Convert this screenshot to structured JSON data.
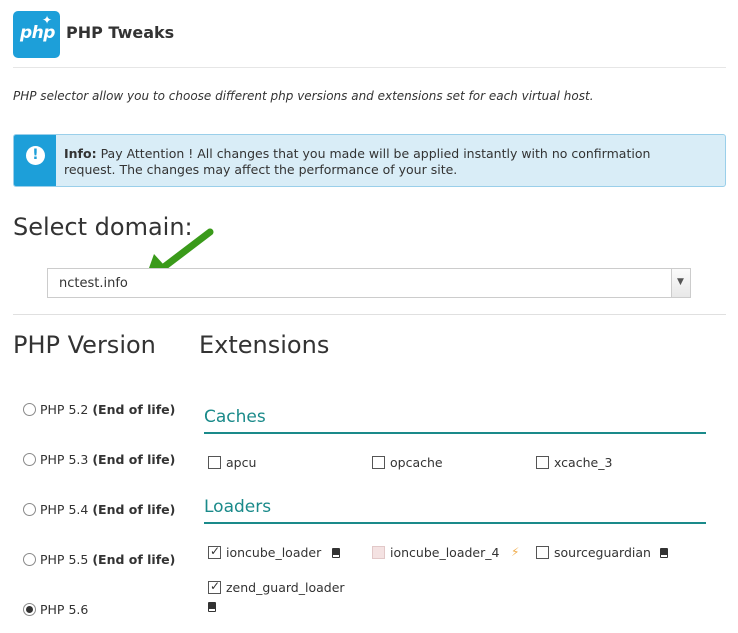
{
  "header": {
    "logo_text": "php",
    "title": "PHP Tweaks"
  },
  "description": "PHP selector allow you to choose different php versions and extensions set for each virtual host.",
  "info": {
    "label": "Info:",
    "message": "Pay Attention ! All changes that you made will be applied instantly with no confirmation request. The changes may affect the performance of your site."
  },
  "domain": {
    "heading": "Select domain:",
    "selected": "nctest.info"
  },
  "php_version": {
    "heading": "PHP Version",
    "options": [
      {
        "version": "PHP 5.2",
        "note": "(End of life)",
        "selected": false
      },
      {
        "version": "PHP 5.3",
        "note": "(End of life)",
        "selected": false
      },
      {
        "version": "PHP 5.4",
        "note": "(End of life)",
        "selected": false
      },
      {
        "version": "PHP 5.5",
        "note": "(End of life)",
        "selected": false
      },
      {
        "version": "PHP 5.6",
        "note": "",
        "selected": true
      }
    ]
  },
  "extensions": {
    "heading": "Extensions",
    "groups": [
      {
        "title": "Caches",
        "items": [
          {
            "name": "apcu",
            "checked": false
          },
          {
            "name": "opcache",
            "checked": false
          },
          {
            "name": "xcache_3",
            "checked": false
          }
        ]
      },
      {
        "title": "Loaders",
        "items": [
          {
            "name": "ioncube_loader",
            "checked": true,
            "icon": "book-icon"
          },
          {
            "name": "ioncube_loader_4",
            "checked": false,
            "disabled": true,
            "icon": "bolt-icon"
          },
          {
            "name": "sourceguardian",
            "checked": false,
            "icon": "book-icon"
          },
          {
            "name": "zend_guard_loader",
            "checked": true,
            "icon": "book-icon"
          }
        ]
      }
    ]
  },
  "colors": {
    "accent": "#1d9fd9",
    "section": "#1a8a8a",
    "info_bg": "#d9edf7",
    "arrow": "#3a9a1a"
  }
}
